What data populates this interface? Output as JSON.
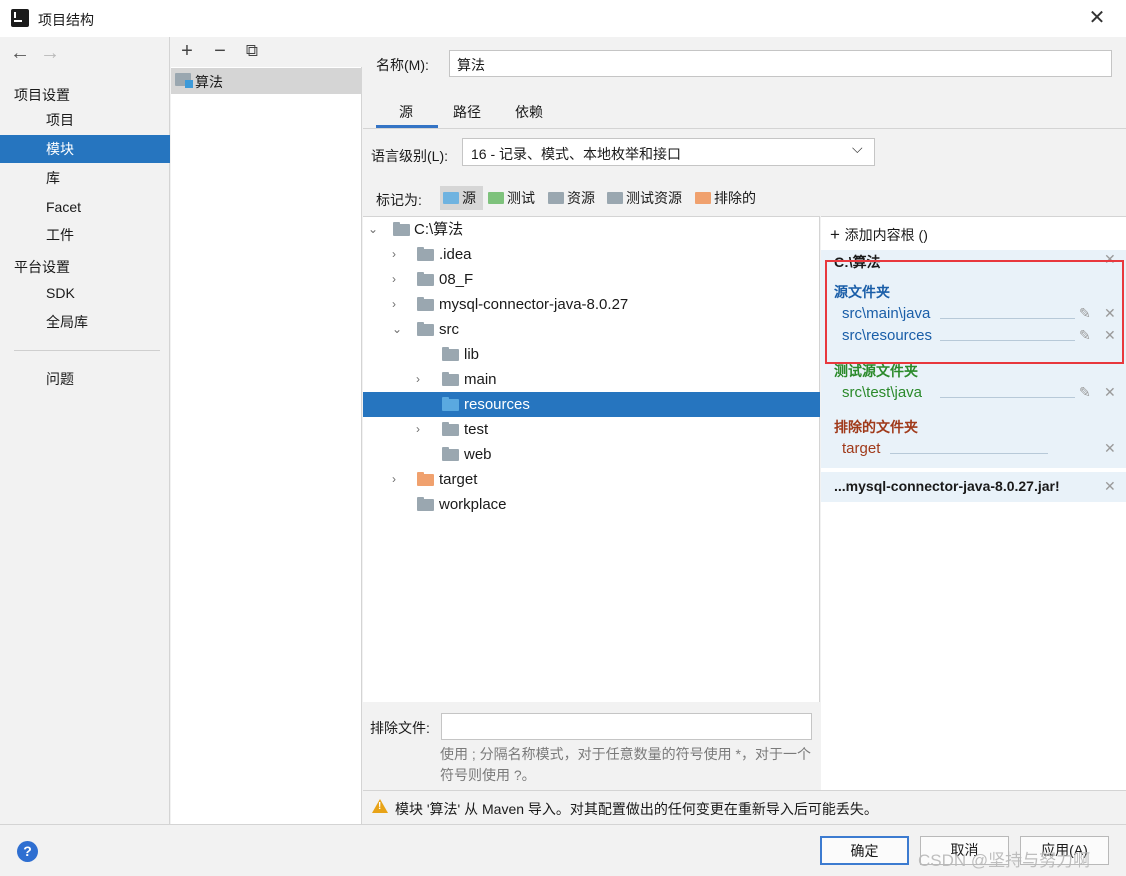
{
  "window": {
    "title": "项目结构"
  },
  "nav": {
    "back_icon": "←",
    "forward_icon": "→",
    "section_project": "项目设置",
    "project_items": [
      "项目",
      "模块",
      "库",
      "Facet",
      "工件"
    ],
    "section_platform": "平台设置",
    "platform_items": [
      "SDK",
      "全局库"
    ],
    "problems": "问题",
    "selected": "模块"
  },
  "modules": {
    "toolbar": {
      "add": "+",
      "remove": "−",
      "copy": "⧉"
    },
    "items": [
      "算法"
    ]
  },
  "module": {
    "name_label": "名称(M):",
    "name_value": "算法",
    "tabs": [
      "源",
      "路径",
      "依赖"
    ],
    "active_tab": "源",
    "lang_label": "语言级别(L):",
    "lang_value": "16 - 记录、模式、本地枚举和接口",
    "mark_label": "标记为:",
    "mark_items": [
      {
        "label": "源",
        "color": "#6fb3e0"
      },
      {
        "label": "测试",
        "color": "#7ec27c"
      },
      {
        "label": "资源",
        "color": "#9aa7b0"
      },
      {
        "label": "测试资源",
        "color": "#9aa7b0"
      },
      {
        "label": "排除的",
        "color": "#f0a16e"
      }
    ]
  },
  "tree": [
    {
      "label": "C:\\算法",
      "chev": "⌄"
    },
    {
      "label": ".idea",
      "chev": "›"
    },
    {
      "label": "08_F",
      "chev": "›"
    },
    {
      "label": "mysql-connector-java-8.0.27",
      "chev": "›"
    },
    {
      "label": "src",
      "chev": "⌄"
    },
    {
      "label": "lib",
      "chev": ""
    },
    {
      "label": "main",
      "chev": "›"
    },
    {
      "label": "resources",
      "chev": ""
    },
    {
      "label": "test",
      "chev": "›"
    },
    {
      "label": "web",
      "chev": ""
    },
    {
      "label": "target",
      "chev": "›"
    },
    {
      "label": "workplace",
      "chev": ""
    }
  ],
  "roots": {
    "add_label": "添加内容根 ()",
    "root_name": "C:\\算法",
    "source_title": "源文件夹",
    "source_paths": [
      "src\\main\\java",
      "src\\resources"
    ],
    "test_title": "测试源文件夹",
    "test_paths": [
      "src\\test\\java"
    ],
    "excluded_title": "排除的文件夹",
    "excluded_paths": [
      "target"
    ],
    "root2_name": "...mysql-connector-java-8.0.27.jar!",
    "colors": {
      "source": "#1a5ea8",
      "test": "#2b8a2b",
      "excluded": "#a03a1a"
    }
  },
  "exclude": {
    "label": "排除文件:",
    "value": "",
    "hint": "使用 ; 分隔名称模式，对于任意数量的符号使用 *，对于一个符号则使用 ?。"
  },
  "warning": "模块 '算法' 从 Maven 导入。对其配置做出的任何变更在重新导入后可能丢失。",
  "footer": {
    "help": "?",
    "ok": "确定",
    "cancel": "取消",
    "apply": "应用(A)"
  },
  "watermark": "CSDN @坚持与努力啊"
}
